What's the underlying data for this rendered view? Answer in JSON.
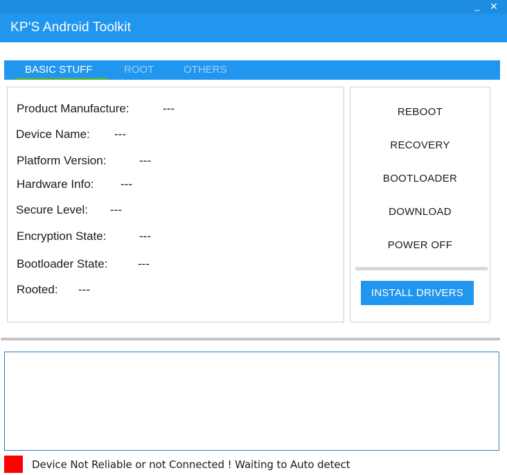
{
  "window": {
    "title": "KP'S Android Toolkit",
    "minimize_glyph": "_",
    "close_glyph": "✕"
  },
  "tabs": [
    {
      "label": "BASIC STUFF",
      "active": true
    },
    {
      "label": "ROOT",
      "active": false
    },
    {
      "label": "OTHERS",
      "active": false
    }
  ],
  "device_info": [
    {
      "label": "Product Manufacture:",
      "value": "---"
    },
    {
      "label": "Device Name:",
      "value": "---"
    },
    {
      "label": "Platform Version:",
      "value": "---"
    },
    {
      "label": "Hardware Info:",
      "value": "---"
    },
    {
      "label": "Secure Level:",
      "value": "---"
    },
    {
      "label": "Encryption State:",
      "value": "---"
    },
    {
      "label": "Bootloader State:",
      "value": "---"
    },
    {
      "label": "Rooted:",
      "value": "---"
    }
  ],
  "actions": {
    "reboot": "REBOOT",
    "recovery": "RECOVERY",
    "bootloader": "BOOTLOADER",
    "download": "DOWNLOAD",
    "power_off": "POWER OFF",
    "install_drivers": "INSTALL DRIVERS"
  },
  "log": {
    "content": ""
  },
  "status": {
    "indicator_color": "#ff0000",
    "text": "Device Not Reliable or not Connected ! Waiting to Auto detect"
  },
  "colors": {
    "accent": "#2196ee",
    "tab_underline": "#4caf50",
    "inactive_tab_text": "#9dd0f8"
  }
}
